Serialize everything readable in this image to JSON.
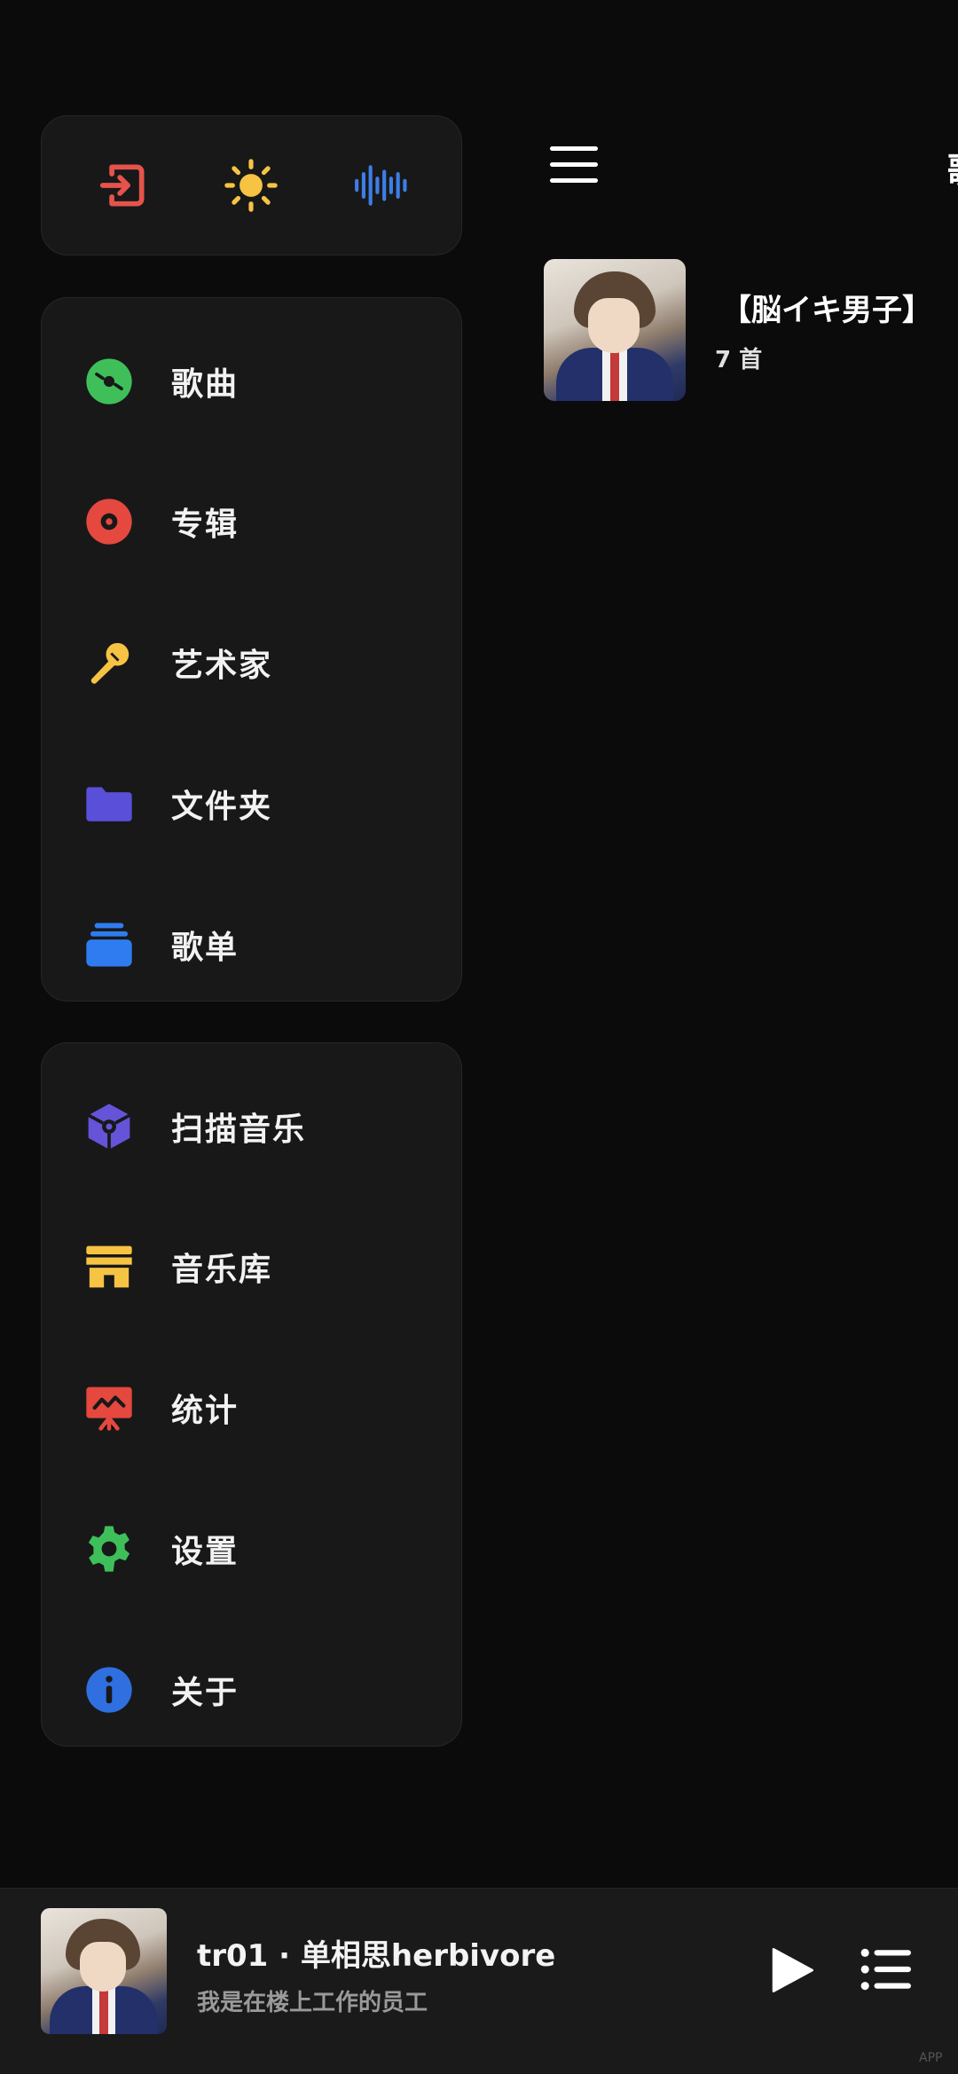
{
  "quick_actions": [
    {
      "name": "exit-icon",
      "color": "#e5534b"
    },
    {
      "name": "sun-icon",
      "color": "#f6c343"
    },
    {
      "name": "waveform-icon",
      "color": "#3d7ee6"
    }
  ],
  "library_menu": [
    {
      "label": "歌曲",
      "icon": "disc-icon",
      "color": "#3fbf5a"
    },
    {
      "label": "专辑",
      "icon": "vinyl-icon",
      "color": "#e5483e"
    },
    {
      "label": "艺术家",
      "icon": "microphone-icon",
      "color": "#f6c343"
    },
    {
      "label": "文件夹",
      "icon": "folder-icon",
      "color": "#5a4fd8"
    },
    {
      "label": "歌单",
      "icon": "playlist-stack-icon",
      "color": "#2f7cf0"
    }
  ],
  "system_menu": [
    {
      "label": "扫描音乐",
      "icon": "scan-cube-icon",
      "color": "#6554d8"
    },
    {
      "label": "音乐库",
      "icon": "store-icon",
      "color": "#f6c343"
    },
    {
      "label": "统计",
      "icon": "chart-board-icon",
      "color": "#e5483e"
    },
    {
      "label": "设置",
      "icon": "gear-icon",
      "color": "#3fbf5a"
    },
    {
      "label": "关于",
      "icon": "info-icon",
      "color": "#2f6fe0"
    }
  ],
  "header": {
    "title_peek": "歌"
  },
  "album": {
    "name": "【脳イキ男子】",
    "count": "7 首"
  },
  "now_playing": {
    "title": "tr01 · 单相思herbivore",
    "artist": "我是在楼上工作的员工"
  },
  "watermark": "APP"
}
